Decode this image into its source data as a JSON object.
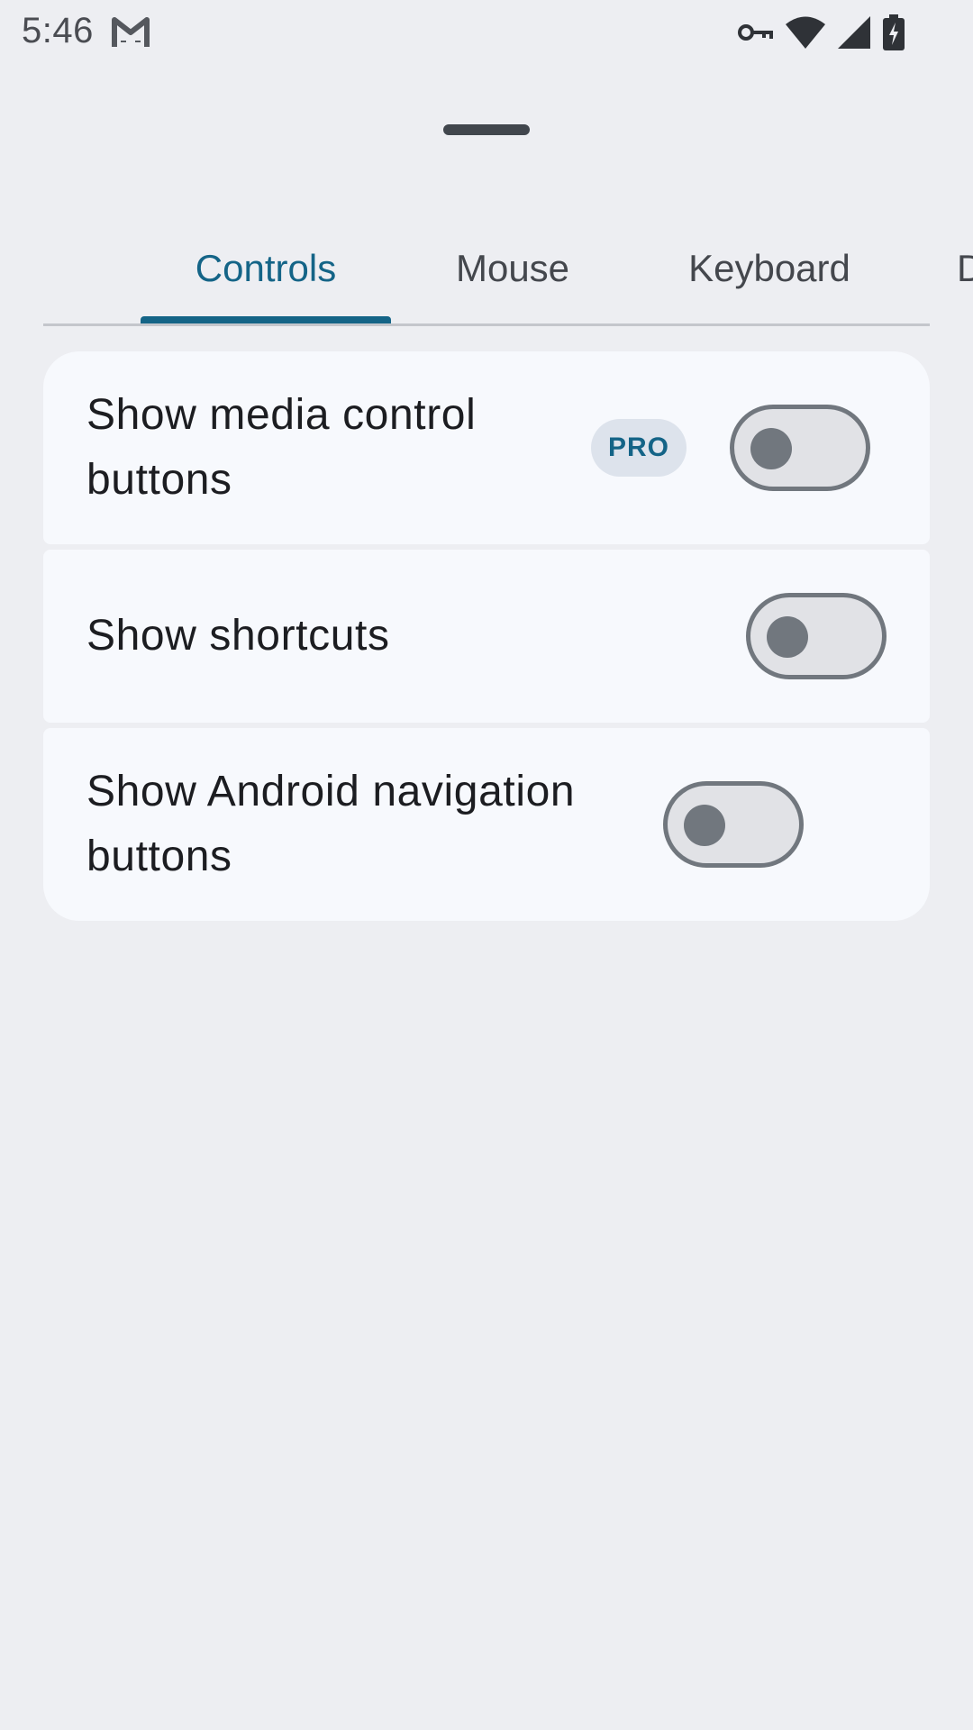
{
  "status_bar": {
    "time": "5:46",
    "icons": [
      "gmail-icon",
      "vpn-key-icon",
      "wifi-icon",
      "cell-signal-icon",
      "battery-charging-icon"
    ]
  },
  "tabs": [
    {
      "label": "Controls",
      "selected": true
    },
    {
      "label": "Mouse",
      "selected": false
    },
    {
      "label": "Keyboard",
      "selected": false
    },
    {
      "label": "D",
      "selected": false
    }
  ],
  "settings": [
    {
      "label": "Show media control buttons",
      "badge": "PRO",
      "enabled": false
    },
    {
      "label": "Show shortcuts",
      "enabled": false
    },
    {
      "label": "Show Android navigation buttons",
      "enabled": false
    }
  ],
  "colors": {
    "accent": "#146487",
    "background": "#edeef2",
    "card": "#f7f9fd",
    "switch_outline": "#71777e"
  }
}
